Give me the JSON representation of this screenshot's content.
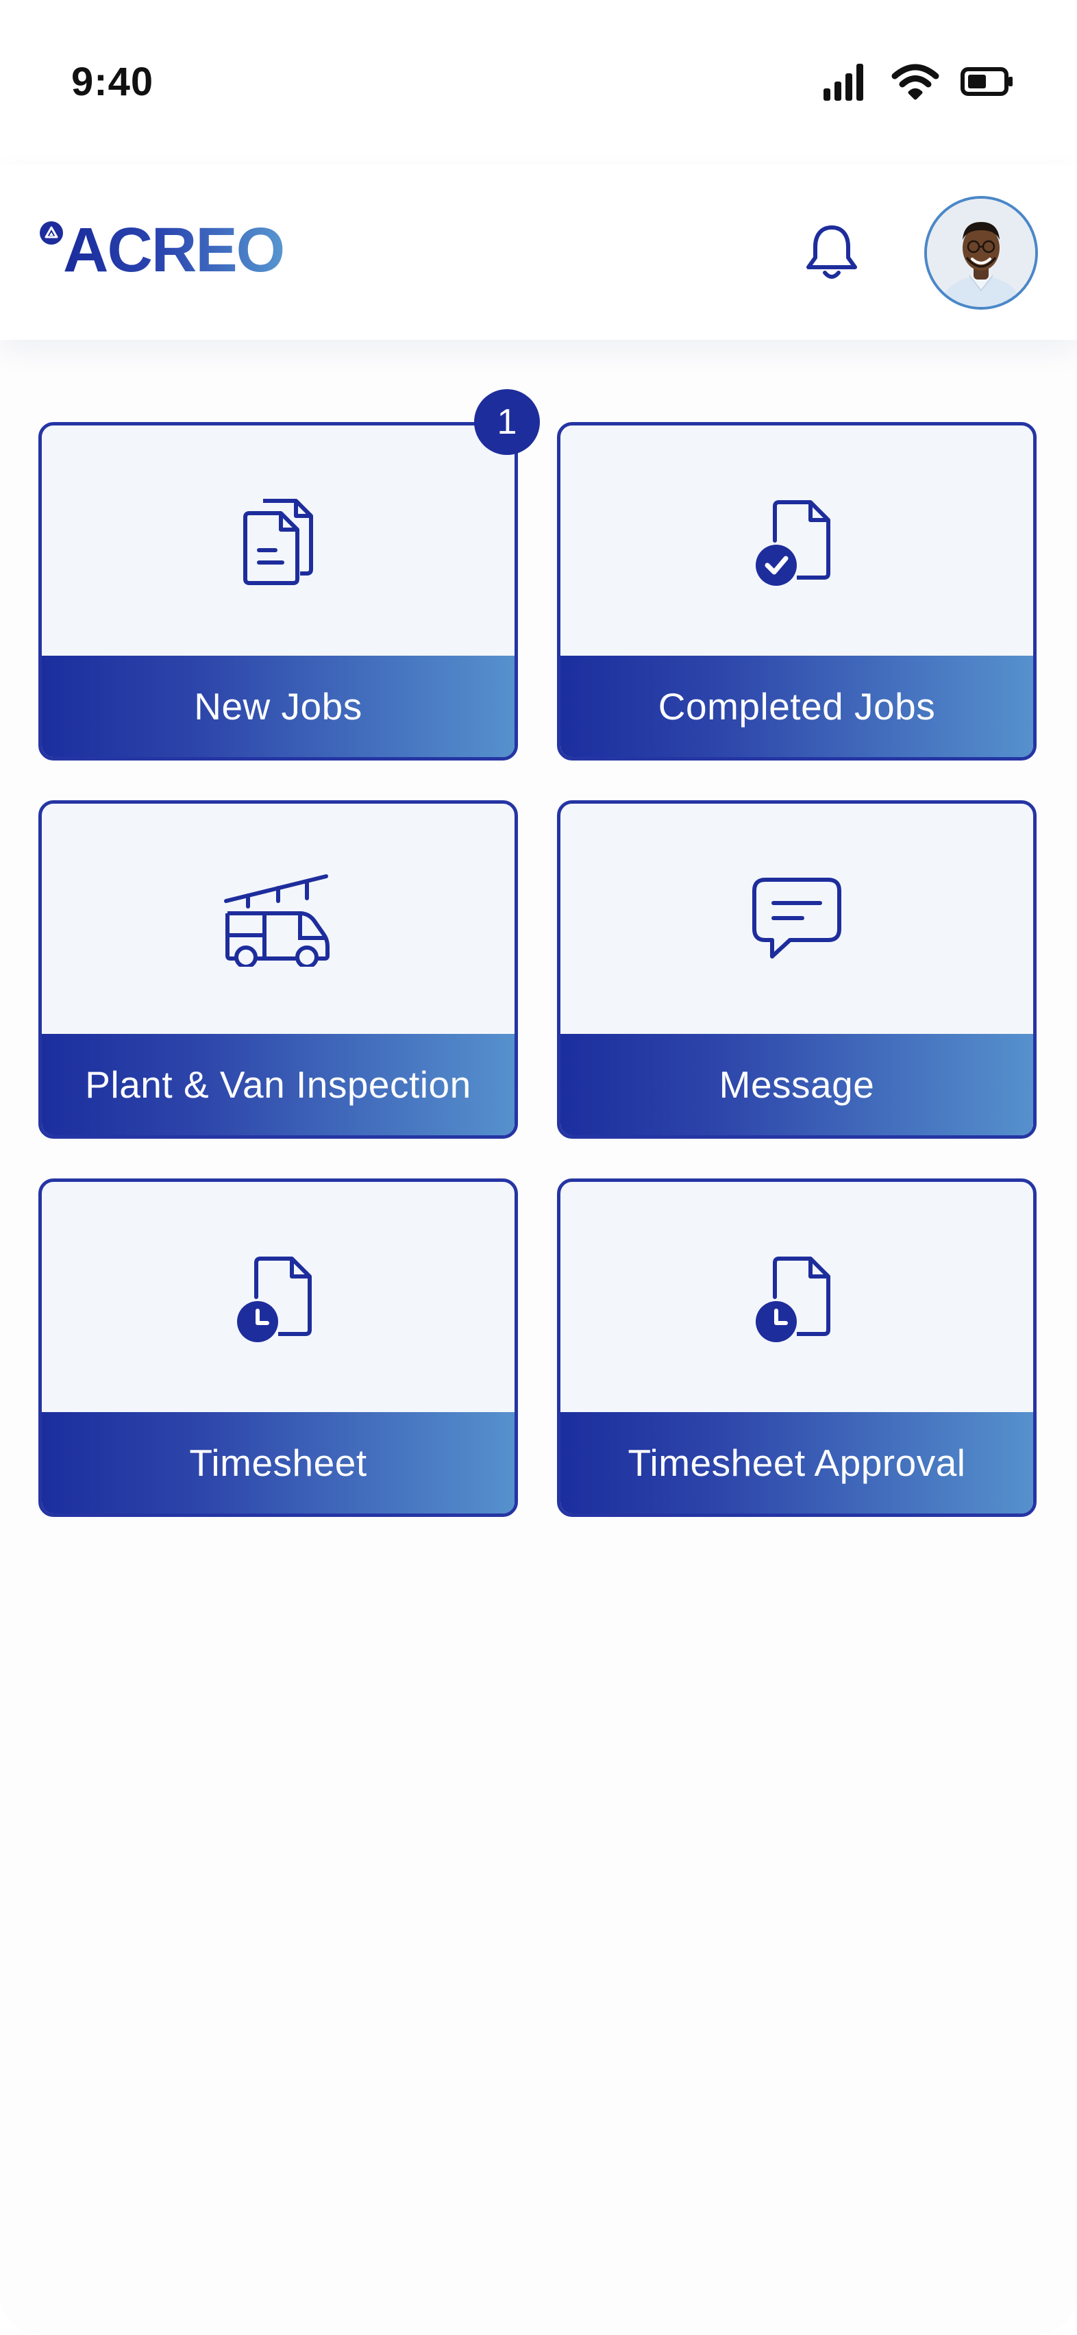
{
  "status_bar": {
    "time": "9:40",
    "icons": [
      "cellular-signal-icon",
      "wifi-icon",
      "battery-icon"
    ]
  },
  "header": {
    "logo_text": "ACREO",
    "icons": [
      "bell-icon"
    ],
    "avatar": "user-avatar"
  },
  "tiles": [
    {
      "label": "New Jobs",
      "icon": "documents-icon",
      "badge": "1"
    },
    {
      "label": "Completed Jobs",
      "icon": "document-check-icon"
    },
    {
      "label": "Plant & Van Inspection",
      "icon": "van-ladder-icon"
    },
    {
      "label": "Message",
      "icon": "chat-bubble-icon"
    },
    {
      "label": "Timesheet",
      "icon": "document-clock-icon"
    },
    {
      "label": "Timesheet Approval",
      "icon": "document-clock-icon"
    }
  ],
  "colors": {
    "primary": "#1e2d9c",
    "gradient_start": "#1c2e9e",
    "gradient_end": "#5691cd",
    "tile_background": "#f3f6fb"
  }
}
